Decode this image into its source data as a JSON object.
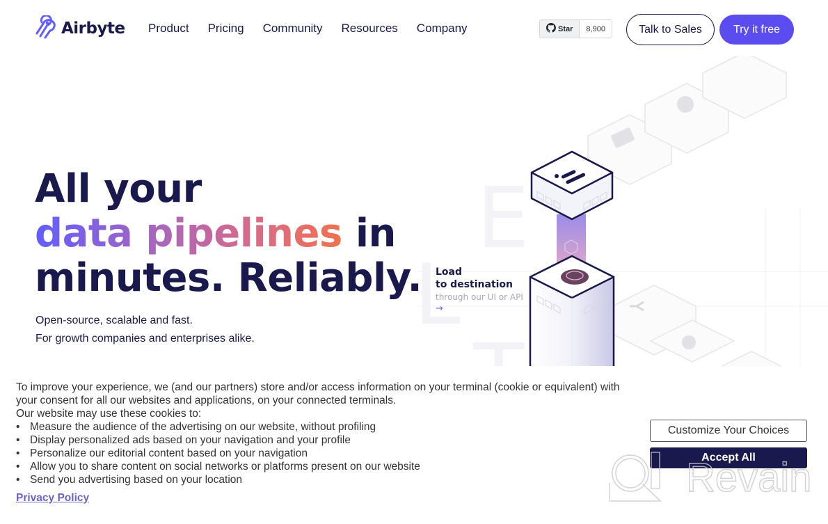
{
  "header": {
    "brand": "Airbyte",
    "nav": [
      "Product",
      "Pricing",
      "Community",
      "Resources",
      "Company"
    ],
    "github": {
      "label": "Star",
      "count": "8,900",
      "icon": "github-icon"
    },
    "talk_to_sales": "Talk to Sales",
    "try_free": "Try it  free"
  },
  "hero": {
    "title_line1": "All your",
    "title_gradient": "data pipelines",
    "title_line2_rest": " in",
    "title_line3": "minutes. Reliably.",
    "sub1": "Open-source, scalable and fast.",
    "sub2": "For growth companies and enterprises alike."
  },
  "illustration": {
    "step_title_1": "Load",
    "step_title_2": "to destination",
    "step_sub": "through our UI or API",
    "arrow": "→",
    "bg_letters": [
      "E",
      "L",
      "T"
    ]
  },
  "cookie_banner": {
    "intro": "To improve your experience, we (and our partners) store and/or access information on your terminal (cookie or equivalent) with your consent for all our websites and applications, on your connected terminals.",
    "lead": "Our website may use these cookies to:",
    "purposes": [
      "Measure the audience of the advertising on our website, without profiling",
      "Display personalized ads based on your navigation and your profile",
      "Personalize our editorial content based on your navigation",
      "Allow you to share content on social networks or platforms present on our website",
      "Send you advertising based on your location"
    ],
    "privacy_link": "Privacy Policy",
    "customize": "Customize Your Choices",
    "accept": "Accept All"
  },
  "watermark": {
    "text": "Revain"
  },
  "colors": {
    "brand_dark": "#1a194d",
    "brand_primary": "#5b4cf0",
    "gradient_start": "#615eff",
    "gradient_end": "#f0714f",
    "link": "#6c63c7"
  }
}
